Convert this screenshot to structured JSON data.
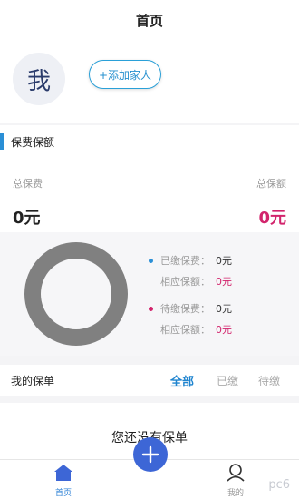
{
  "header": {
    "title": "首页"
  },
  "family": {
    "avatar_text": "我",
    "add_label": "+添加家人"
  },
  "premium_section": {
    "title": "保费保额"
  },
  "totals": {
    "left_label": "总保费",
    "left_value": "0元",
    "right_label": "总保额",
    "right_value": "0元"
  },
  "legend": {
    "paid_label": "已缴保费：",
    "paid_value": "0元",
    "paid_cover_label": "相应保额：",
    "paid_cover_value": "0元",
    "pending_label": "待缴保费：",
    "pending_value": "0元",
    "pending_cover_label": "相应保额：",
    "pending_cover_value": "0元"
  },
  "policies": {
    "title": "我的保单",
    "tabs": [
      "全部",
      "已缴",
      "待缴"
    ],
    "empty_text": "您还没有保单"
  },
  "tabbar": {
    "home": "首页",
    "mine": "我的"
  },
  "watermark": "pc6",
  "colors": {
    "accent": "#2a8fd6",
    "pink": "#d2246c",
    "fab": "#3d66d6",
    "donut": "#808080"
  }
}
